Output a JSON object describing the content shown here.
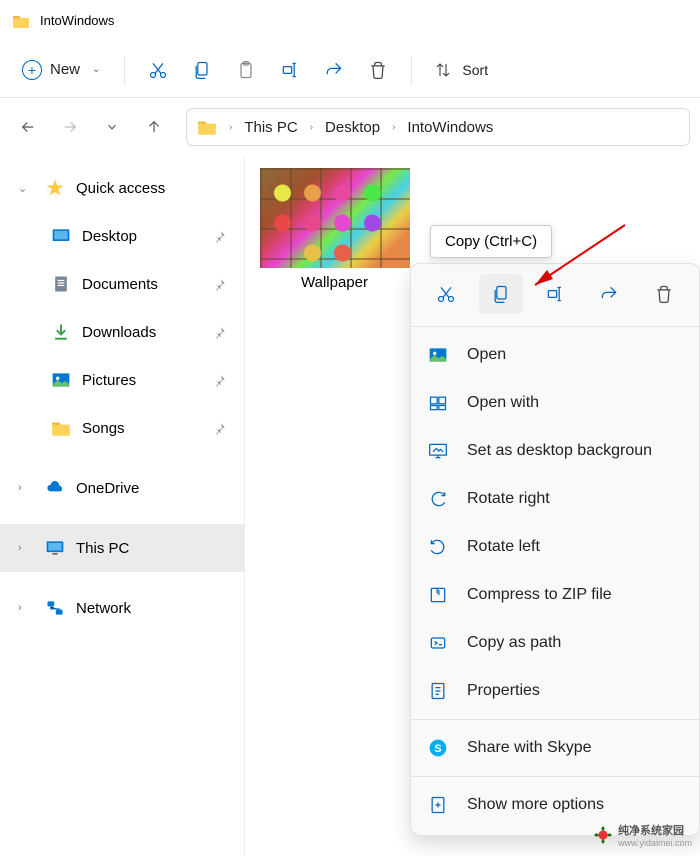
{
  "window": {
    "title": "IntoWindows"
  },
  "toolbar": {
    "new_label": "New",
    "sort_label": "Sort"
  },
  "breadcrumb": {
    "items": [
      "This PC",
      "Desktop",
      "IntoWindows"
    ]
  },
  "sidebar": {
    "quick_access": "Quick access",
    "items": [
      {
        "label": "Desktop"
      },
      {
        "label": "Documents"
      },
      {
        "label": "Downloads"
      },
      {
        "label": "Pictures"
      },
      {
        "label": "Songs"
      }
    ],
    "onedrive": "OneDrive",
    "thispc": "This PC",
    "network": "Network"
  },
  "file": {
    "name": "Wallpaper"
  },
  "tooltip": {
    "text": "Copy (Ctrl+C)"
  },
  "context_menu": {
    "items": [
      "Open",
      "Open with",
      "Set as desktop backgroun",
      "Rotate right",
      "Rotate left",
      "Compress to ZIP file",
      "Copy as path",
      "Properties",
      "Share with Skype",
      "Show more options"
    ]
  },
  "watermark": {
    "text1": "纯净系统家园",
    "text2": "www.yidaimei.com"
  }
}
